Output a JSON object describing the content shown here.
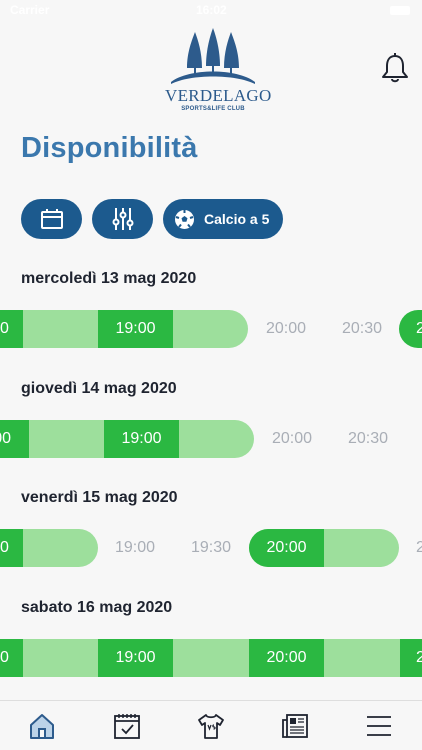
{
  "status": {
    "carrier": "Carrier",
    "time": "16:02"
  },
  "brand": {
    "name": "VERDELAGO",
    "tagline": "SPORTS&LIFE CLUB"
  },
  "page": {
    "title": "Disponibilità"
  },
  "filters": {
    "sport": "Calcio a 5"
  },
  "days": [
    {
      "date": "mercoledì 13 mag 2020",
      "selected": "19:00",
      "free": [
        "20:00",
        "20:30"
      ],
      "edge_left": "0",
      "edge_right": "2"
    },
    {
      "date": "giovedì 14 mag 2020",
      "selected": "19:00",
      "free": [
        "20:00",
        "20:30"
      ],
      "edge_left": "00"
    },
    {
      "date": "venerdì 15 mag 2020",
      "free": [
        "19:00",
        "19:30"
      ],
      "selected": "20:00",
      "edge_left": "0",
      "edge_right": "2"
    },
    {
      "date": "sabato 16 mag 2020",
      "selected": [
        "19:00",
        "20:00"
      ],
      "edge_left": "0",
      "edge_right": "2"
    }
  ],
  "colors": {
    "brand_blue": "#1c5a8e",
    "title_blue": "#3b78ad",
    "slot_available": "#9ddf9c",
    "slot_selected": "#2bb842",
    "slot_free_text": "#a9aeb6"
  },
  "icons": {
    "calendar": "calendar-icon",
    "filter": "sliders-icon",
    "sport": "soccer-ball-icon",
    "notifications": "bell-icon",
    "tabs": [
      "home-icon",
      "calendar-check-icon",
      "shirt-icon",
      "news-icon",
      "menu-icon"
    ]
  }
}
